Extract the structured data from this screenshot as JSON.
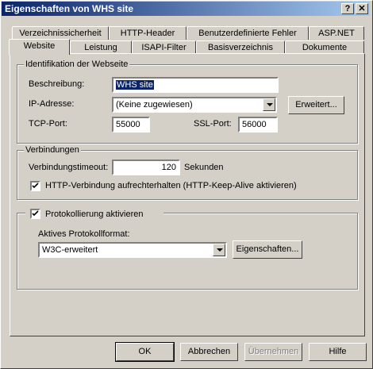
{
  "window": {
    "title": "Eigenschaften von WHS site"
  },
  "titlebar": {
    "help_glyph": "?",
    "close_glyph": "✕"
  },
  "tabs_row1": [
    {
      "label": "Verzeichnissicherheit"
    },
    {
      "label": "HTTP-Header"
    },
    {
      "label": "Benutzerdefinierte Fehler"
    },
    {
      "label": "ASP.NET"
    }
  ],
  "tabs_row2": [
    {
      "label": "Website",
      "active": true
    },
    {
      "label": "Leistung"
    },
    {
      "label": "ISAPI-Filter"
    },
    {
      "label": "Basisverzeichnis"
    },
    {
      "label": "Dokumente"
    }
  ],
  "identification": {
    "legend": "Identifikation der Webseite",
    "description_label": "Beschreibung:",
    "description_value": "WHS site",
    "ip_label": "IP-Adresse:",
    "ip_value": "(Keine zugewiesen)",
    "advanced_button": "Erweitert...",
    "tcp_label": "TCP-Port:",
    "tcp_value": "55000",
    "ssl_label": "SSL-Port:",
    "ssl_value": "56000"
  },
  "connections": {
    "legend": "Verbindungen",
    "timeout_label": "Verbindungstimeout:",
    "timeout_value": "120",
    "timeout_unit": "Sekunden",
    "keepalive_label": "HTTP-Verbindung aufrechterhalten (HTTP-Keep-Alive aktivieren)",
    "keepalive_checked": true
  },
  "logging": {
    "enable_label": "Protokollierung aktivieren",
    "enable_checked": true,
    "format_label": "Aktives Protokollformat:",
    "format_value": "W3C-erweitert",
    "properties_button": "Eigenschaften..."
  },
  "buttons": {
    "ok": "OK",
    "cancel": "Abbrechen",
    "apply": "Übernehmen",
    "help": "Hilfe"
  },
  "colors": {
    "face": "#d4d0c8",
    "title_start": "#0a246a",
    "title_end": "#a6caf0"
  }
}
